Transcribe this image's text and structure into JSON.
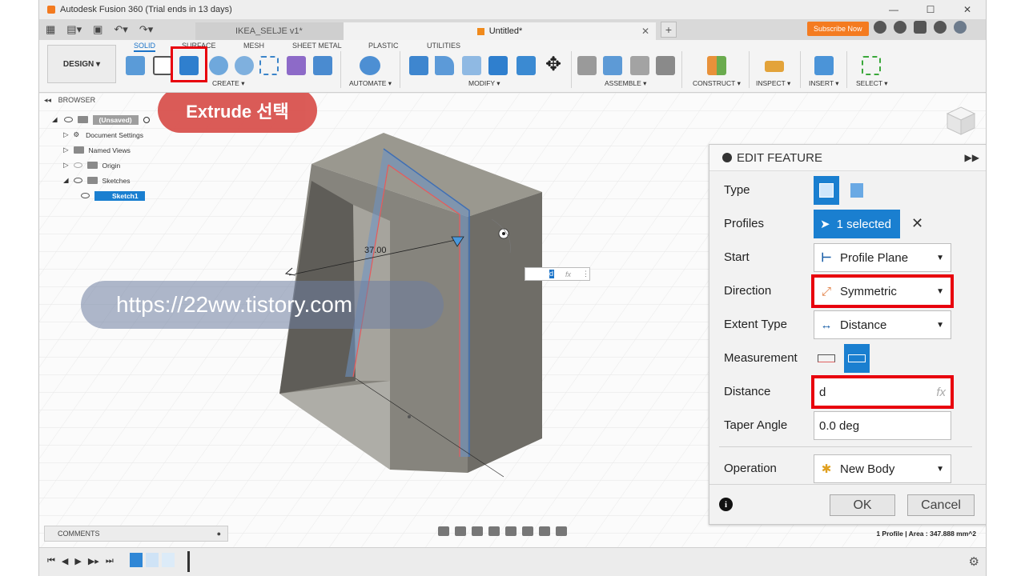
{
  "window": {
    "title": "Autodesk Fusion 360 (Trial ends in 13 days)"
  },
  "tabs": [
    {
      "label": "IKEA_SELJE v1*"
    },
    {
      "label": "Untitled*"
    }
  ],
  "header": {
    "subscribe_label": "Subscribe Now"
  },
  "ribbon": {
    "design_label": "DESIGN ▾",
    "tabs": [
      "SOLID",
      "SURFACE",
      "MESH",
      "SHEET METAL",
      "PLASTIC",
      "UTILITIES"
    ],
    "groups": [
      "CREATE ▾",
      "AUTOMATE ▾",
      "MODIFY ▾",
      "ASSEMBLE ▾",
      "CONSTRUCT ▾",
      "INSPECT ▾",
      "INSERT ▾",
      "SELECT ▾"
    ]
  },
  "browser": {
    "title": "BROWSER",
    "items": [
      "(Unsaved)",
      "Document Settings",
      "Named Views",
      "Origin",
      "Sketches",
      "Sketch1"
    ]
  },
  "annotations": {
    "callout": "Extrude 선택",
    "watermark": "https://22ww.tistory.com"
  },
  "viewport": {
    "dimension_label": "37.00",
    "dim_input_value": "d",
    "fx_label": "fx"
  },
  "edit_feature": {
    "title": "EDIT FEATURE",
    "type_label": "Type",
    "profiles_label": "Profiles",
    "profiles_value": "1 selected",
    "start_label": "Start",
    "start_value": "Profile Plane",
    "direction_label": "Direction",
    "direction_value": "Symmetric",
    "extent_label": "Extent Type",
    "extent_value": "Distance",
    "measurement_label": "Measurement",
    "distance_label": "Distance",
    "distance_value": "d",
    "taper_label": "Taper Angle",
    "taper_value": "0.0 deg",
    "operation_label": "Operation",
    "operation_value": "New Body",
    "ok_label": "OK",
    "cancel_label": "Cancel",
    "fx_label": "fx"
  },
  "status": {
    "comments_label": "COMMENTS",
    "selection_info": "1 Profile | Area : 347.888 mm^2"
  },
  "colors": {
    "accent": "#1a7fd0",
    "highlight": "#e8000d",
    "callout": "#d9534f",
    "body_face": "#7f7d77"
  }
}
